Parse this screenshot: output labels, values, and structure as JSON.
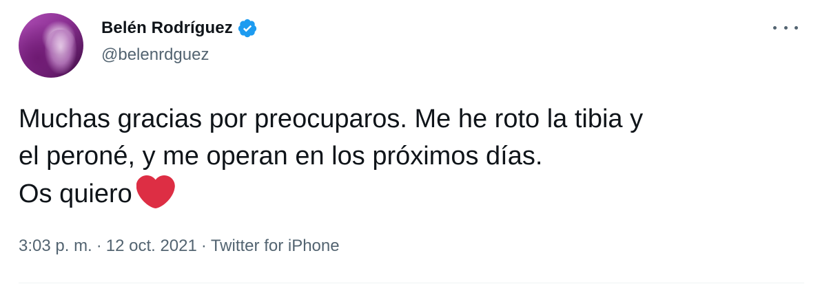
{
  "user": {
    "display_name": "Belén Rodríguez",
    "handle": "@belenrdguez",
    "verified": true
  },
  "tweet": {
    "lines": [
      "Muchas gracias por preocuparos. Me he roto la tibia y",
      "el peroné, y me operan en los próximos días.",
      "Os quiero"
    ],
    "emoji": "red-heart-icon"
  },
  "meta": {
    "time": "3:03 p. m.",
    "date": "12 oct. 2021",
    "source": "Twitter for iPhone",
    "separator": "·"
  },
  "colors": {
    "verified_badge": "#1d9bf0",
    "heart": "#dd2e44",
    "secondary_text": "#536471"
  }
}
